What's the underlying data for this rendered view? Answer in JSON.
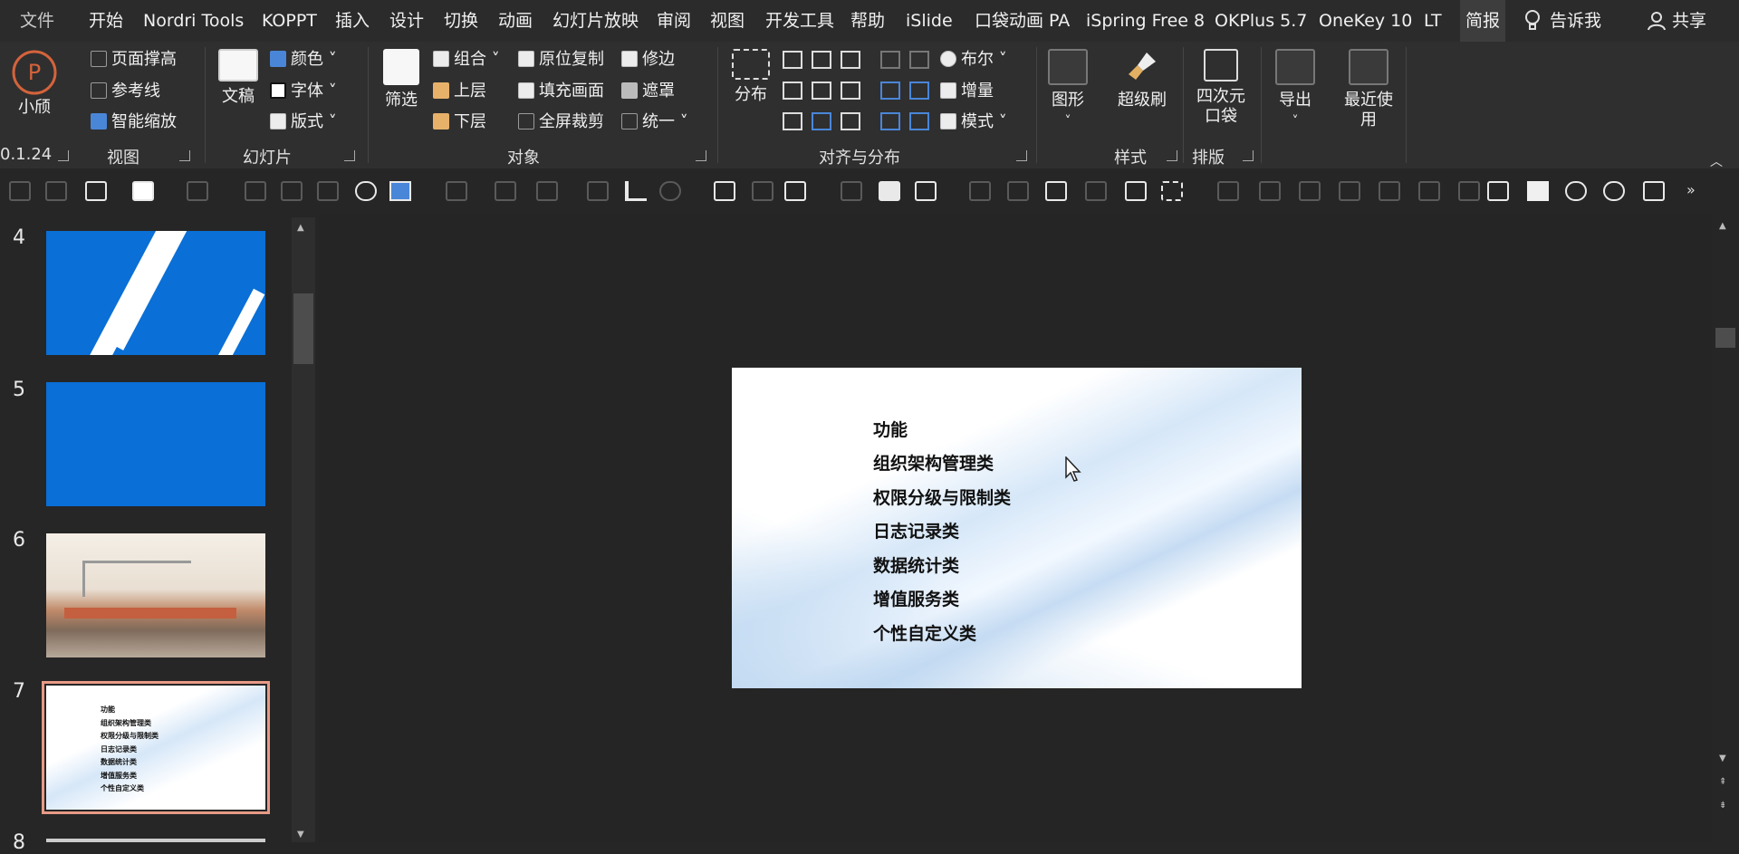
{
  "menu": {
    "file": "文件",
    "tabs": [
      "开始",
      "Nordri Tools",
      "KOPPT",
      "插入",
      "设计",
      "切换",
      "动画",
      "幻灯片放映",
      "审阅",
      "视图",
      "开发工具",
      "帮助",
      "iSlide",
      "口袋动画 PA",
      "iSpring Free 8",
      "OKPlus 5.7",
      "OneKey 10",
      "LT",
      "简报"
    ],
    "active_tab": "简报",
    "tell_me": "告诉我",
    "share": "共享"
  },
  "ribbon": {
    "xiaoying": "小颀",
    "version": "0.1.24",
    "view_group": {
      "items": [
        "页面撑高",
        "参考线",
        "智能缩放"
      ],
      "label": "视图"
    },
    "slide_group": {
      "wengao": "文稿",
      "items": [
        "颜色",
        "字体",
        "版式"
      ],
      "label": "幻灯片"
    },
    "object_group": {
      "shaixuan": "筛选",
      "col1": [
        "组合",
        "上层",
        "下层"
      ],
      "col2": [
        "原位复制",
        "填充画面",
        "全屏裁剪"
      ],
      "col3": [
        "修边",
        "遮罩",
        "统一"
      ],
      "label": "对象"
    },
    "align_group": {
      "fenbu": "分布",
      "col": [
        "布尔",
        "增量",
        "模式"
      ],
      "label": "对齐与分布"
    },
    "style_group": {
      "tuxing": "图形",
      "chaojishua": "超级刷",
      "label": "样式"
    },
    "layout_group": {
      "sici": "四次元口袋",
      "label": "排版"
    },
    "export": "导出",
    "recent": "最近使用"
  },
  "thumbnails": [
    {
      "num": "4",
      "kind": "blue-diagonal"
    },
    {
      "num": "5",
      "kind": "solid-blue"
    },
    {
      "num": "6",
      "kind": "port-photo"
    },
    {
      "num": "7",
      "kind": "text-list",
      "selected": true
    },
    {
      "num": "8",
      "kind": "partial"
    }
  ],
  "slide": {
    "lines": [
      "功能",
      "组织架构管理类",
      "权限分级与限制类",
      "日志记录类",
      "数据统计类",
      "增值服务类",
      "个性自定义类"
    ]
  },
  "colors": {
    "accent": "#e89a86",
    "blue": "#0a6fd6"
  }
}
